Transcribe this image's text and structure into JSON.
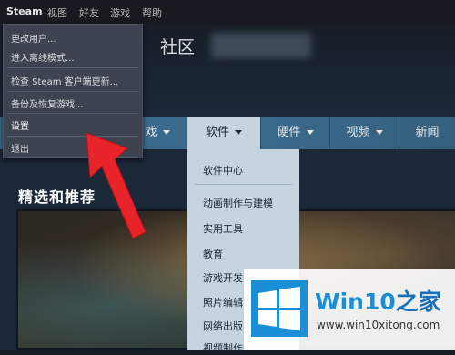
{
  "menubar": {
    "items": [
      "Steam",
      "视图",
      "好友",
      "游戏",
      "帮助"
    ]
  },
  "header": {
    "community": "社区",
    "store_partial": "戏"
  },
  "storenav": {
    "items": [
      {
        "label": "戏",
        "caret": true
      },
      {
        "label": "软件",
        "caret": true
      },
      {
        "label": "硬件",
        "caret": true
      },
      {
        "label": "视频",
        "caret": true
      },
      {
        "label": "新闻",
        "caret": false
      }
    ]
  },
  "steam_menu": {
    "items": [
      "更改用户...",
      "进入离线模式...",
      "检查 Steam 客户端更新...",
      "备份及恢复游戏...",
      "设置",
      "退出"
    ]
  },
  "software_menu": {
    "items": [
      "软件中心",
      "动画制作与建模",
      "实用工具",
      "教育",
      "游戏开发",
      "照片编辑",
      "网络出版",
      "视频制作"
    ]
  },
  "content": {
    "section_title": "精选和推荐"
  },
  "watermark": {
    "brand": "Win10",
    "brand_cn": "之家",
    "url": "www.win10xitong.com"
  },
  "colors": {
    "nav_bg": "#3d6c8d",
    "nav_active": "#c6d4df",
    "menu_bg": "#3d4450",
    "arrow": "#e8232a",
    "brand": "#1a8fd6"
  }
}
